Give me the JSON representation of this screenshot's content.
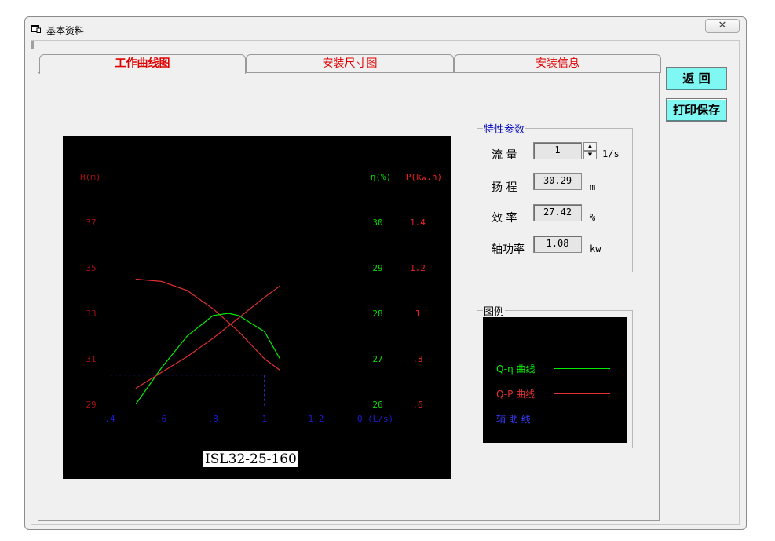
{
  "window": {
    "title": "基本资料",
    "close_glyph": "✕",
    "icon": "window-app-icon"
  },
  "tabs": [
    {
      "label": "工作曲线图",
      "active": true
    },
    {
      "label": "安装尺寸图",
      "active": false
    },
    {
      "label": "安装信息",
      "active": false
    }
  ],
  "buttons": {
    "back": "返  回",
    "print_save": "打印保存"
  },
  "chart_data": {
    "type": "line",
    "model": "ISL32-25-160",
    "xlabel": "Q (L/s)",
    "x_ticks": [
      ".4",
      ".6",
      ".8",
      "1",
      "1.2"
    ],
    "x_range": [
      0.4,
      1.4
    ],
    "axes": {
      "head": {
        "label": "H(m)",
        "ticks": [
          "37",
          "35",
          "33",
          "31",
          "29"
        ],
        "range": [
          29,
          37
        ]
      },
      "eff": {
        "label": "η(%)",
        "ticks": [
          "30",
          "29",
          "28",
          "27",
          "26"
        ],
        "range": [
          26,
          30
        ]
      },
      "power": {
        "label": "P(kw.h)",
        "ticks": [
          "1.4",
          "1.2",
          "1",
          ".8",
          ".6"
        ],
        "range": [
          0.6,
          1.4
        ]
      }
    },
    "series": [
      {
        "name": "Q-H",
        "axis": "head",
        "color": "#e03030",
        "x": [
          0.5,
          0.6,
          0.7,
          0.8,
          0.9,
          1.0,
          1.06
        ],
        "y": [
          34.5,
          34.4,
          34.0,
          33.2,
          32.2,
          31.0,
          30.5
        ]
      },
      {
        "name": "Q-η",
        "axis": "eff",
        "color": "#00ee00",
        "x": [
          0.5,
          0.6,
          0.7,
          0.8,
          0.86,
          0.9,
          1.0,
          1.06
        ],
        "y": [
          26.0,
          26.8,
          27.5,
          27.95,
          28.0,
          27.95,
          27.6,
          27.0
        ]
      },
      {
        "name": "Q-P",
        "axis": "power",
        "color": "#e03030",
        "x": [
          0.5,
          0.6,
          0.7,
          0.8,
          0.9,
          1.0,
          1.06
        ],
        "y": [
          0.67,
          0.74,
          0.81,
          0.89,
          0.98,
          1.07,
          1.12
        ]
      }
    ],
    "operating_point": {
      "q": 1,
      "h": 30.29,
      "color": "#3a3aff"
    }
  },
  "params": {
    "title": "特性参数",
    "flow": {
      "label": "流  量",
      "value": "1",
      "unit": "1/s"
    },
    "head": {
      "label": "扬  程",
      "value": "30.29",
      "unit": "m"
    },
    "efficiency": {
      "label": "效  率",
      "value": "27.42",
      "unit": "%"
    },
    "shaft_power": {
      "label": "轴功率",
      "value": "1.08",
      "unit": "kw"
    }
  },
  "legend": {
    "title": "图例",
    "items": [
      {
        "label": "Q-η 曲线",
        "color": "#00ee00",
        "style": "solid"
      },
      {
        "label": "Q-P 曲线",
        "color": "#e03030",
        "style": "solid"
      },
      {
        "label": "辅 助 线",
        "color": "#3a3aff",
        "style": "dashed"
      }
    ]
  }
}
